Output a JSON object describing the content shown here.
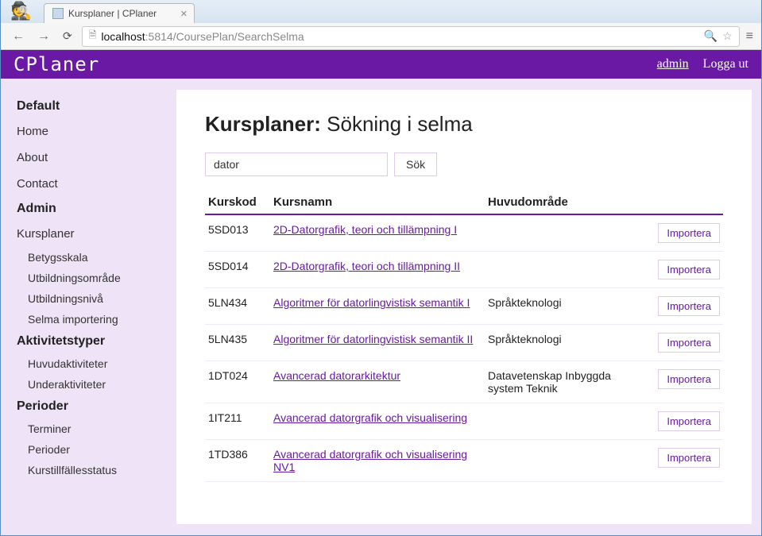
{
  "window": {
    "tab_title": "Kursplaner | CPlaner",
    "url_host": "localhost",
    "url_port": ":5814",
    "url_path": "/CoursePlan/SearchSelma"
  },
  "appbar": {
    "title": "CPlaner",
    "user": "admin",
    "logout": "Logga ut"
  },
  "sidebar": {
    "groups": [
      {
        "label": "Default",
        "items": [
          "Home",
          "About",
          "Contact"
        ],
        "subs": []
      },
      {
        "label": "Admin",
        "items": [
          "Kursplaner"
        ],
        "subs": [
          "Betygsskala",
          "Utbildningsområde",
          "Utbildningsnivå",
          "Selma importering"
        ]
      },
      {
        "label": "Aktivitetstyper",
        "items": [],
        "subs": [
          "Huvudaktiviteter",
          "Underaktiviteter"
        ]
      },
      {
        "label": "Perioder",
        "items": [],
        "subs": [
          "Terminer",
          "Perioder",
          "Kurstillfällesstatus"
        ]
      }
    ]
  },
  "main": {
    "heading_bold": "Kursplaner:",
    "heading_rest": " Sökning i selma",
    "search_value": "dator",
    "search_label": "Sök",
    "columns": {
      "code": "Kurskod",
      "name": "Kursnamn",
      "area": "Huvudområde"
    },
    "import_label": "Importera",
    "rows": [
      {
        "code": "5SD013",
        "name": "2D-Datorgrafik, teori och tillämpning I",
        "area": ""
      },
      {
        "code": "5SD014",
        "name": "2D-Datorgrafik, teori och tillämpning II",
        "area": ""
      },
      {
        "code": "5LN434",
        "name": "Algoritmer för datorlingvistisk semantik I",
        "area": "Språkteknologi"
      },
      {
        "code": "5LN435",
        "name": "Algoritmer för datorlingvistisk semantik II",
        "area": "Språkteknologi"
      },
      {
        "code": "1DT024",
        "name": "Avancerad datorarkitektur",
        "area": "Datavetenskap Inbyggda system Teknik"
      },
      {
        "code": "1IT211",
        "name": "Avancerad datorgrafik och visualisering",
        "area": ""
      },
      {
        "code": "1TD386",
        "name": "Avancerad datorgrafik och visualisering NV1",
        "area": ""
      }
    ]
  }
}
